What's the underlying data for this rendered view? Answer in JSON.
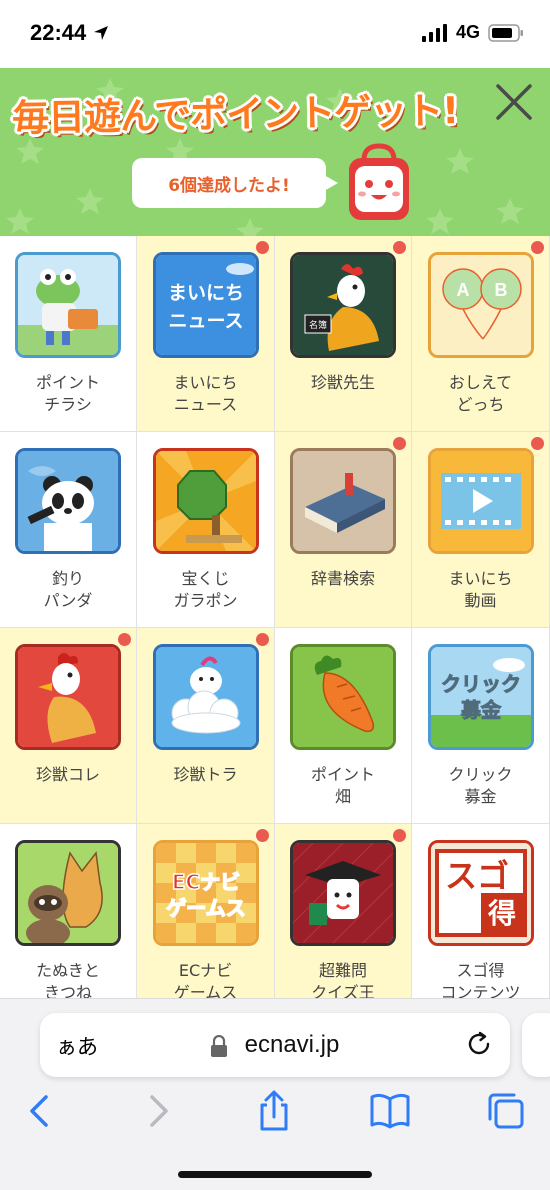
{
  "status": {
    "time": "22:44",
    "network": "4G"
  },
  "banner": {
    "title": "毎日遊んでポイントゲット!",
    "message": "6個達成したよ!",
    "close_icon": "close-icon"
  },
  "grid": {
    "items": [
      {
        "label": "ポイント\nチラシ",
        "icon": "frog-icon",
        "highlight": false,
        "badge": false
      },
      {
        "label": "まいにち\nニュース",
        "icon": "news-icon",
        "highlight": true,
        "badge": true
      },
      {
        "label": "珍獣先生",
        "icon": "rooster-teacher-icon",
        "highlight": true,
        "badge": true
      },
      {
        "label": "おしえて\nどっち",
        "icon": "balloons-icon",
        "highlight": true,
        "badge": true
      },
      {
        "label": "釣り\nパンダ",
        "icon": "panda-icon",
        "highlight": false,
        "badge": false
      },
      {
        "label": "宝くじ\nガラポン",
        "icon": "lottery-icon",
        "highlight": false,
        "badge": false
      },
      {
        "label": "辞書検索",
        "icon": "dictionary-icon",
        "highlight": true,
        "badge": true
      },
      {
        "label": "まいにち\n動画",
        "icon": "video-icon",
        "highlight": true,
        "badge": true
      },
      {
        "label": "珍獣コレ",
        "icon": "chicken-icon",
        "highlight": true,
        "badge": true
      },
      {
        "label": "珍獣トラ",
        "icon": "cloud-creature-icon",
        "highlight": true,
        "badge": true
      },
      {
        "label": "ポイント\n畑",
        "icon": "carrot-icon",
        "highlight": false,
        "badge": false
      },
      {
        "label": "クリック\n募金",
        "icon": "click-donation-icon",
        "highlight": false,
        "badge": false
      },
      {
        "label": "たぬきと\nきつね",
        "icon": "tanuki-fox-icon",
        "highlight": false,
        "badge": false
      },
      {
        "label": "ECナビ\nゲームス",
        "icon": "ecnavi-games-icon",
        "highlight": true,
        "badge": true
      },
      {
        "label": "超難問\nクイズ王",
        "icon": "quiz-king-icon",
        "highlight": true,
        "badge": true
      },
      {
        "label": "スゴ得\nコンテンツ",
        "icon": "sugotoku-icon",
        "highlight": false,
        "badge": false
      }
    ],
    "tile_texts": {
      "news": "まいにち\nニュース",
      "teacher_sign": "名簿",
      "balloon_a": "A",
      "balloon_b": "B",
      "donation": "クリック\n募金",
      "games": "ECナビ\nゲームス",
      "sugo": "スゴ",
      "toku": "得"
    }
  },
  "browser": {
    "text_size": "ぁあ",
    "domain": "ecnavi.jp"
  },
  "colors": {
    "banner_green": "#8fd46e",
    "title_orange": "#ff7a1f",
    "highlight": "#fff8c8",
    "badge_red": "#ea5a4e",
    "ios_blue": "#2f7cf6"
  }
}
